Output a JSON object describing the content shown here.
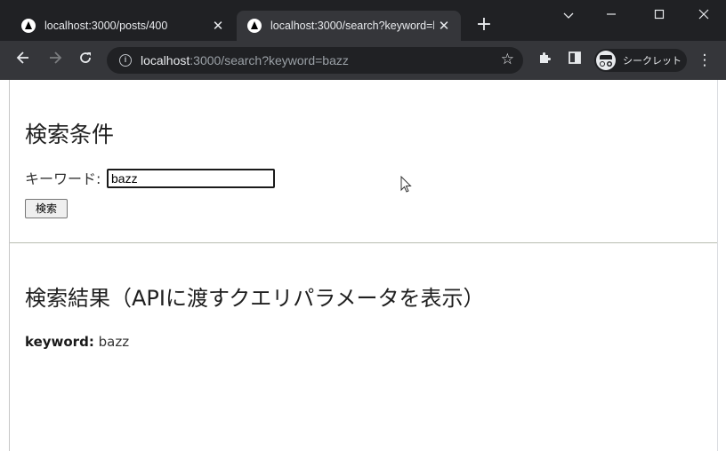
{
  "browser": {
    "tabs": [
      {
        "title": "localhost:3000/posts/400",
        "active": false
      },
      {
        "title": "localhost:3000/search?keyword=bazz",
        "active": true
      }
    ],
    "address_host": "localhost",
    "address_rest": ":3000/search?keyword=bazz",
    "incognito_label": "シークレット",
    "colors": {
      "tabstrip": "#202124",
      "toolbar": "#35363a",
      "text": "#e8eaed"
    }
  },
  "page": {
    "search_heading": "検索条件",
    "keyword_label": "キーワード:",
    "keyword_value": "bazz",
    "search_button": "検索",
    "result_heading": "検索結果（APIに渡すクエリパラメータを表示）",
    "result_key": "keyword:",
    "result_value": "bazz"
  }
}
